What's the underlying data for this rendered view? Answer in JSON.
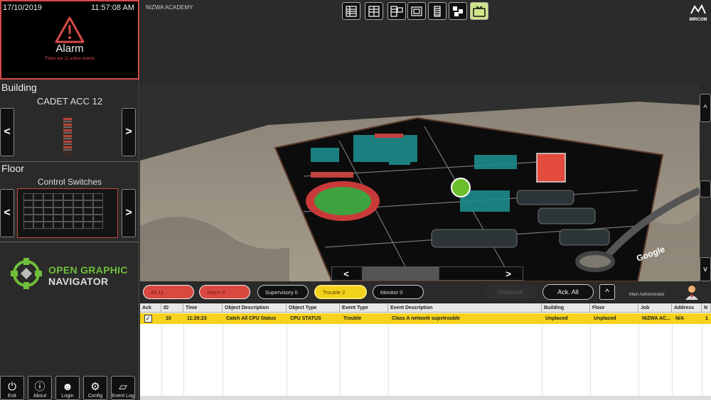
{
  "alarm": {
    "date": "17/10/2019",
    "time": "11:57:08  AM",
    "title": "Alarm",
    "subtitle": "There are 11 active events"
  },
  "building": {
    "label": "Building",
    "name": "CADET ACC 12",
    "prev": "<",
    "next": ">"
  },
  "floor": {
    "label": "Floor",
    "name": "Control Switches",
    "prev": "<",
    "next": ">"
  },
  "brand_logo": {
    "line1": "OPEN GRAPHIC",
    "line2": "NAVIGATOR"
  },
  "bottom_buttons": [
    {
      "label": "Exit",
      "icon": "power-icon"
    },
    {
      "label": "About",
      "icon": "info-icon"
    },
    {
      "label": "Login",
      "icon": "users-icon"
    },
    {
      "label": "Config",
      "icon": "gear-icon"
    },
    {
      "label": "Event Log",
      "icon": "log-icon"
    }
  ],
  "header": {
    "site_name": "NIZWA ACADEMY",
    "vendor": "MIRCOM"
  },
  "view_buttons": [
    {
      "icon": "list-view-icon"
    },
    {
      "icon": "split-list-view-icon"
    },
    {
      "icon": "list-map-view-icon"
    },
    {
      "icon": "map-view-icon"
    },
    {
      "icon": "building-view-icon"
    },
    {
      "icon": "tiles-view-icon"
    },
    {
      "icon": "tv-view-icon",
      "active": true
    }
  ],
  "map": {
    "watermark": "Google",
    "up": "^",
    "down": "v",
    "prev": "<",
    "next": ">"
  },
  "filters": {
    "all": "All  11",
    "alarm": "Alarm  9",
    "supervisory": "Supervisory  0",
    "trouble": "Trouble  2",
    "monitor": "Monitor  0",
    "unsilence": "Unsilence",
    "ack_all": "Ack. All",
    "expand": "^",
    "user": "Main Administrator"
  },
  "table": {
    "headers": [
      "Ack",
      "ID",
      "Time",
      "Object Description",
      "Object Type",
      "Event Type",
      "Event Description",
      "Building",
      "Floor",
      "Job",
      "Address",
      "N"
    ],
    "rows": [
      {
        "ack": "✓",
        "id": "10",
        "time": "11:29:23",
        "object_description": "Catch All CPU Status",
        "object_type": "CPU STATUS",
        "event_type": "Trouble",
        "event_description": "Class A network supvtrouble",
        "building": "Unplaced",
        "floor": "Unplaced",
        "job": "NIZWA AC...",
        "address": "N/A",
        "n": "1"
      }
    ]
  },
  "colors": {
    "alarm_red": "#d8493f",
    "trouble_yellow": "#f2d21a",
    "accent_green": "#6fbf3a"
  }
}
